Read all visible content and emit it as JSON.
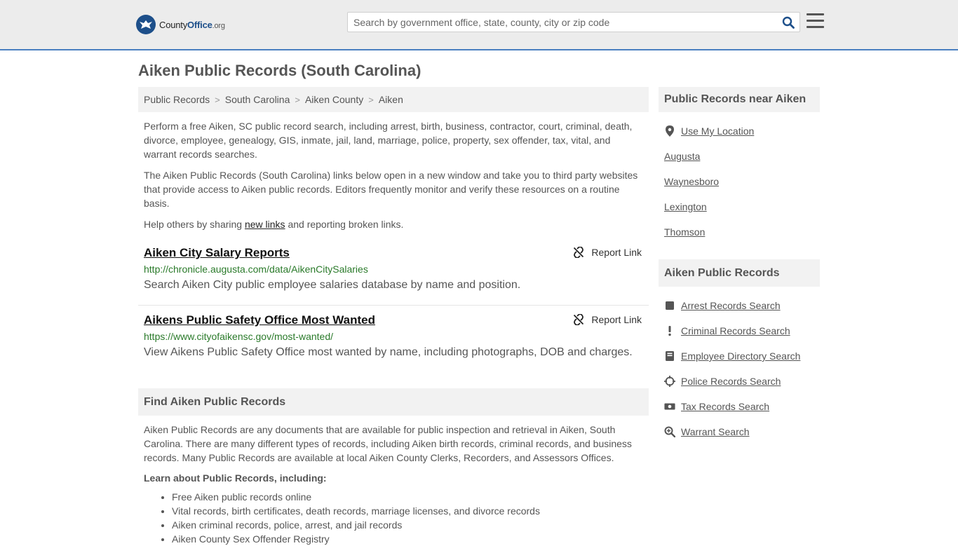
{
  "header": {
    "logo": {
      "brand": "County",
      "brand_bold": "Office",
      "tld": ".org"
    },
    "search": {
      "placeholder": "Search by government office, state, county, city or zip code",
      "value": ""
    }
  },
  "page_title": "Aiken Public Records (South Carolina)",
  "breadcrumb": [
    "Public Records",
    "South Carolina",
    "Aiken County",
    "Aiken"
  ],
  "intro": {
    "p1": "Perform a free Aiken, SC public record search, including arrest, birth, business, contractor, court, criminal, death, divorce, employee, genealogy, GIS, inmate, jail, land, marriage, police, property, sex offender, tax, vital, and warrant records searches.",
    "p2": "The Aiken Public Records (South Carolina) links below open in a new window and take you to third party websites that provide access to Aiken public records. Editors frequently monitor and verify these resources on a routine basis.",
    "p3_before": "Help others by sharing ",
    "p3_link": "new links",
    "p3_after": " and reporting broken links."
  },
  "results": [
    {
      "title": "Aiken City Salary Reports",
      "url": "http://chronicle.augusta.com/data/AikenCitySalaries",
      "description": "Search Aiken City public employee salaries database by name and position.",
      "report_label": "Report Link"
    },
    {
      "title": "Aikens Public Safety Office Most Wanted",
      "url": "https://www.cityofaikensc.gov/most-wanted/",
      "description": "View Aikens Public Safety Office most wanted by name, including photographs, DOB and charges.",
      "report_label": "Report Link"
    }
  ],
  "find_section": {
    "heading": "Find Aiken Public Records",
    "body": "Aiken Public Records are any documents that are available for public inspection and retrieval in Aiken, South Carolina. There are many different types of records, including Aiken birth records, criminal records, and business records. Many Public Records are available at local Aiken County Clerks, Recorders, and Assessors Offices.",
    "learn_heading": "Learn about Public Records, including:",
    "learn_items": [
      "Free Aiken public records online",
      "Vital records, birth certificates, death records, marriage licenses, and divorce records",
      "Aiken criminal records, police, arrest, and jail records",
      "Aiken County Sex Offender Registry"
    ]
  },
  "sidebar": {
    "near_heading": "Public Records near Aiken",
    "use_location": "Use My Location",
    "near_items": [
      "Augusta",
      "Waynesboro",
      "Lexington",
      "Thomson"
    ],
    "records_heading": "Aiken Public Records",
    "records_items": [
      {
        "label": "Arrest Records Search",
        "icon": "square-icon"
      },
      {
        "label": "Criminal Records Search",
        "icon": "exclamation-icon"
      },
      {
        "label": "Employee Directory Search",
        "icon": "book-icon"
      },
      {
        "label": "Police Records Search",
        "icon": "crosshair-icon"
      },
      {
        "label": "Tax Records Search",
        "icon": "money-icon"
      },
      {
        "label": "Warrant Search",
        "icon": "magnify-icon"
      }
    ]
  },
  "colors": {
    "accent": "#4a7fc0",
    "brand": "#1d4f8a",
    "url_green": "#2a7a2a",
    "panel": "#f2f2f2"
  }
}
